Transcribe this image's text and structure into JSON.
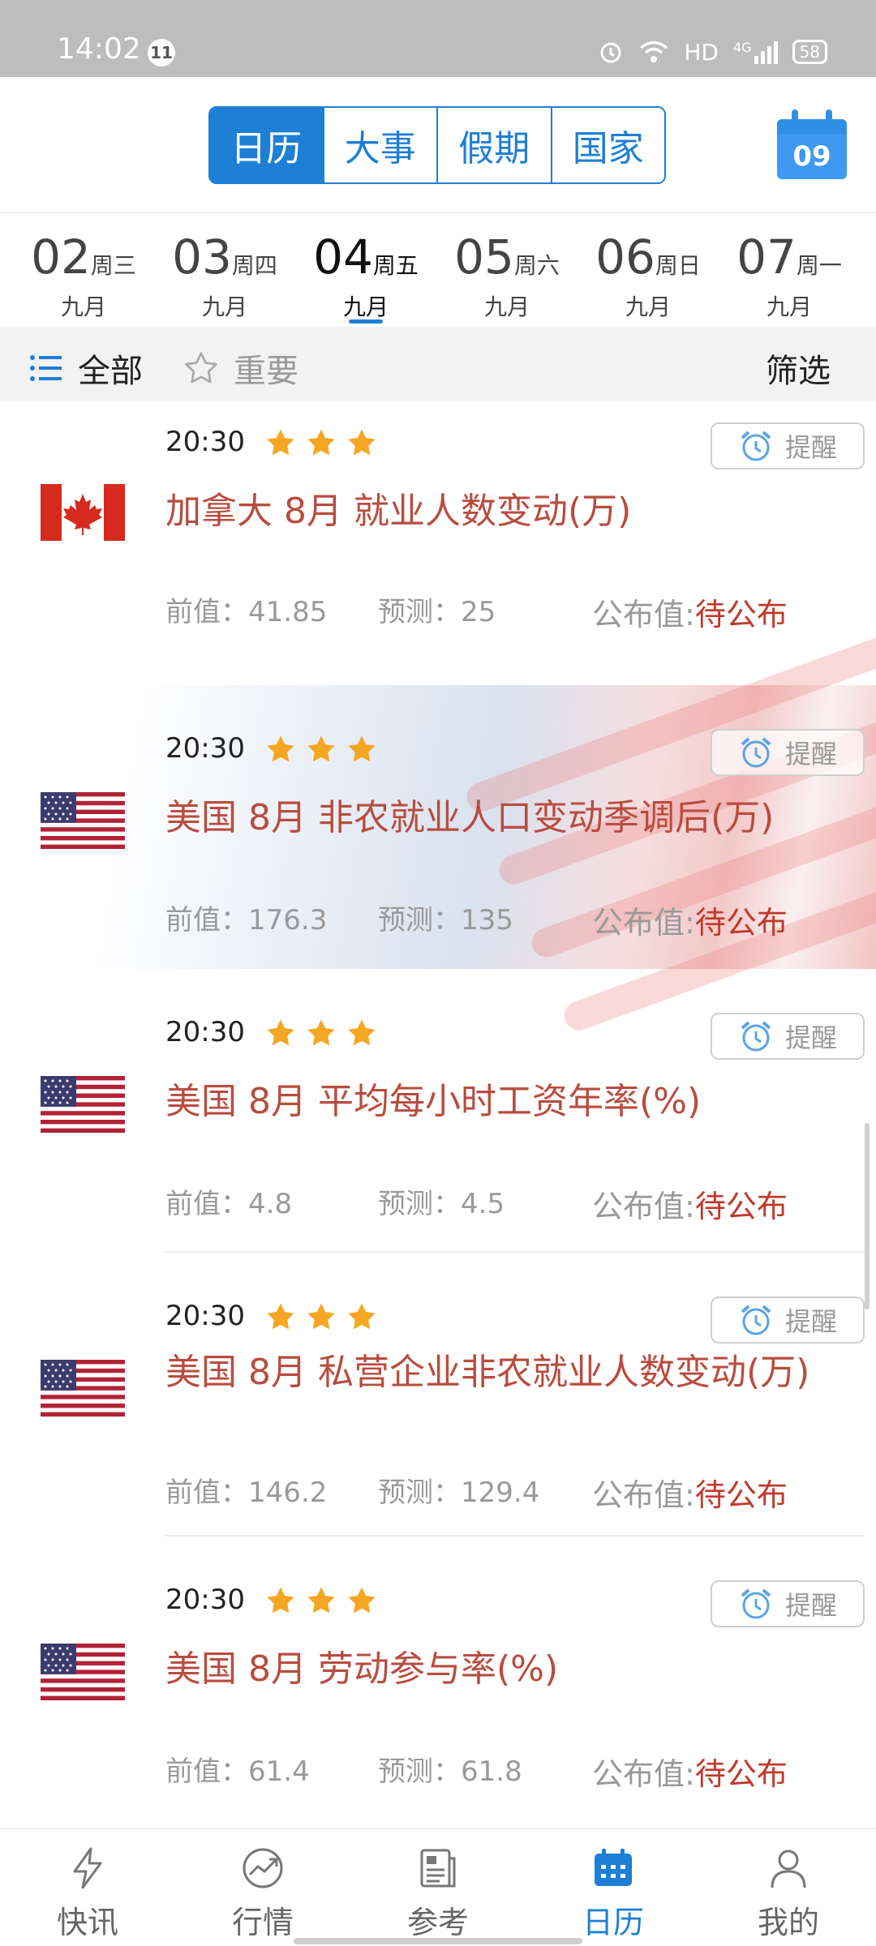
{
  "status_bar": {
    "time": "14:02",
    "notification_count": "11",
    "network": "HD",
    "signal": "4G",
    "battery": "58"
  },
  "header": {
    "tabs": [
      {
        "label": "日历",
        "active": true
      },
      {
        "label": "大事",
        "active": false
      },
      {
        "label": "假期",
        "active": false
      },
      {
        "label": "国家",
        "active": false
      }
    ],
    "calendar_day": "09"
  },
  "date_strip": [
    {
      "day": "02",
      "weekday": "周三",
      "month": "九月",
      "active": false
    },
    {
      "day": "03",
      "weekday": "周四",
      "month": "九月",
      "active": false
    },
    {
      "day": "04",
      "weekday": "周五",
      "month": "九月",
      "active": true
    },
    {
      "day": "05",
      "weekday": "周六",
      "month": "九月",
      "active": false
    },
    {
      "day": "06",
      "weekday": "周日",
      "month": "九月",
      "active": false
    },
    {
      "day": "07",
      "weekday": "周一",
      "month": "九月",
      "active": false
    }
  ],
  "filter_bar": {
    "all_label": "全部",
    "important_label": "重要",
    "filter_label": "筛选"
  },
  "events": [
    {
      "country": "canada",
      "time": "20:30",
      "stars": 3,
      "reminder": "提醒",
      "title": "加拿大 8月 就业人数变动(万)",
      "previous": "前值：41.85",
      "forecast": "预测：25",
      "published_label": "公布值:",
      "published_value": "待公布"
    },
    {
      "country": "usa",
      "time": "20:30",
      "stars": 3,
      "reminder": "提醒",
      "title": "美国 8月 非农就业人口变动季调后(万)",
      "previous": "前值：176.3",
      "forecast": "预测：135",
      "published_label": "公布值:",
      "published_value": "待公布"
    },
    {
      "country": "usa",
      "time": "20:30",
      "stars": 3,
      "reminder": "提醒",
      "title": "美国 8月 平均每小时工资年率(%)",
      "previous": "前值：4.8",
      "forecast": "预测：4.5",
      "published_label": "公布值:",
      "published_value": "待公布"
    },
    {
      "country": "usa",
      "time": "20:30",
      "stars": 3,
      "reminder": "提醒",
      "title": "美国 8月 私营企业非农就业人数变动(万)",
      "previous": "前值：146.2",
      "forecast": "预测：129.4",
      "published_label": "公布值:",
      "published_value": "待公布"
    },
    {
      "country": "usa",
      "time": "20:30",
      "stars": 3,
      "reminder": "提醒",
      "title": "美国 8月 劳动参与率(%)",
      "previous": "前值：61.4",
      "forecast": "预测：61.8",
      "published_label": "公布值:",
      "published_value": "待公布"
    }
  ],
  "bottom_nav": [
    {
      "label": "快讯",
      "icon": "flash-icon",
      "active": false
    },
    {
      "label": "行情",
      "icon": "trend-chart-icon",
      "active": false
    },
    {
      "label": "参考",
      "icon": "document-icon",
      "active": false
    },
    {
      "label": "日历",
      "icon": "calendar-icon",
      "active": true
    },
    {
      "label": "我的",
      "icon": "profile-icon",
      "active": false
    }
  ],
  "colors": {
    "accent": "#1e7fd6",
    "title_red": "#b94c3f",
    "pending_red": "#c0392b",
    "star": "#f5a623"
  }
}
